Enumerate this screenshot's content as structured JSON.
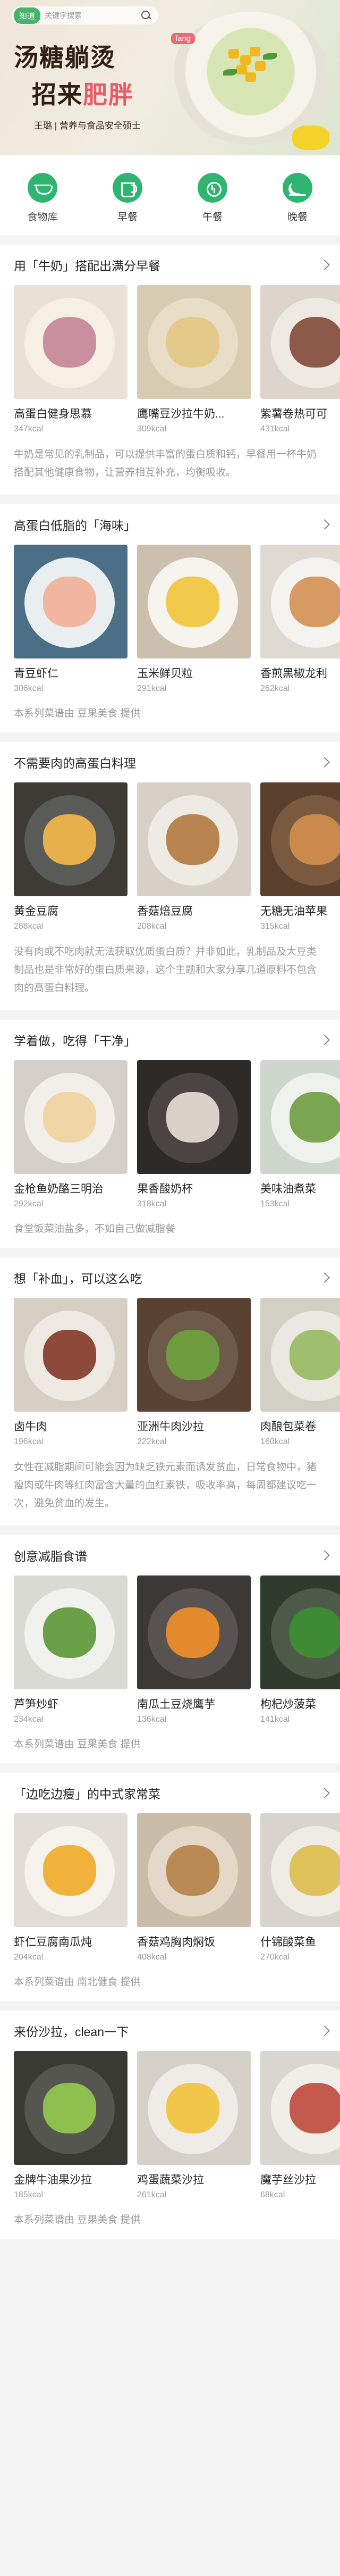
{
  "hero": {
    "search_category": "知道",
    "search_placeholder": "关键字搜索",
    "title_line1": "汤糖躺烫",
    "title_line2_prefix": "招来",
    "title_line2_highlight": "肥胖",
    "tag": "fang",
    "author": "王璐 | 营养与食品安全硕士"
  },
  "nav": [
    {
      "label": "食物库",
      "icon": "bowl-icon"
    },
    {
      "label": "早餐",
      "icon": "cup-icon"
    },
    {
      "label": "午餐",
      "icon": "sun-icon"
    },
    {
      "label": "晚餐",
      "icon": "moon-icon"
    }
  ],
  "colors": {
    "accent": "#2fb471",
    "highlight": "#e85a68"
  },
  "sections": [
    {
      "title": "用「牛奶」搭配出满分早餐",
      "cards": [
        {
          "name": "高蛋白健身思慕",
          "kcal": "347kcal",
          "bg": "#e9e1d6",
          "plate": "#f6efe4",
          "food": "#c98f9e"
        },
        {
          "name": "鹰嘴豆沙拉牛奶...",
          "kcal": "309kcal",
          "bg": "#d7cbb2",
          "plate": "#e8ddc6",
          "food": "#e3c98a"
        },
        {
          "name": "紫薯卷热可可",
          "kcal": "431kcal",
          "bg": "#ddd4cc",
          "plate": "#efe9e4",
          "food": "#8d5a4a"
        }
      ],
      "desc": "牛奶是常见的乳制品，可以提供丰富的蛋白质和钙，早餐用一杯牛奶搭配其他健康食物，让营养相互补充，均衡吸收。",
      "source": ""
    },
    {
      "title": "高蛋白低脂的「海味」",
      "cards": [
        {
          "name": "青豆虾仁",
          "kcal": "306kcal",
          "bg": "#4b6f86",
          "plate": "#e9eef0",
          "food": "#f0b6a0"
        },
        {
          "name": "玉米鲜贝粒",
          "kcal": "291kcal",
          "bg": "#cdbfae",
          "plate": "#f7f3ee",
          "food": "#f1c94b"
        },
        {
          "name": "香煎黑椒龙利",
          "kcal": "262kcal",
          "bg": "#dedad2",
          "plate": "#f5f3ef",
          "food": "#d79a62"
        }
      ],
      "desc": "",
      "source": "本系列菜谱由 豆果美食 提供"
    },
    {
      "title": "不需要肉的高蛋白料理",
      "cards": [
        {
          "name": "黄金豆腐",
          "kcal": "288kcal",
          "bg": "#3e3a36",
          "plate": "#5a5a58",
          "food": "#e8b04a"
        },
        {
          "name": "香菇焙豆腐",
          "kcal": "208kcal",
          "bg": "#d6d0c6",
          "plate": "#eeebe5",
          "food": "#b8844f"
        },
        {
          "name": "无糖无油苹果",
          "kcal": "315kcal",
          "bg": "#5a3f2c",
          "plate": "#7a5a3e",
          "food": "#c98a4c"
        }
      ],
      "desc": "没有肉或不吃肉就无法获取优质蛋白质？并非如此，乳制品及大豆类制品也是非常好的蛋白质来源，这个主题和大家分享几道原料不包含肉的高蛋白料理。",
      "source": ""
    },
    {
      "title": "学着做，吃得「干净」",
      "cards": [
        {
          "name": "金枪鱼奶酪三明治",
          "kcal": "292kcal",
          "bg": "#d4cfc8",
          "plate": "#f2efeb",
          "food": "#f0d6a4"
        },
        {
          "name": "果香酸奶杯",
          "kcal": "318kcal",
          "bg": "#2e2a28",
          "plate": "#4a4442",
          "food": "#d9d2c8"
        },
        {
          "name": "美味油煮菜",
          "kcal": "153kcal",
          "bg": "#cfd6cd",
          "plate": "#eef1ec",
          "food": "#7aa552"
        }
      ],
      "desc": "",
      "source": "食堂饭菜油盐多，不如自己做减脂餐"
    },
    {
      "title": "想「补血」，可以这么吃",
      "cards": [
        {
          "name": "卤牛肉",
          "kcal": "196kcal",
          "bg": "#d8cfc4",
          "plate": "#eee9e2",
          "food": "#8b4a3a"
        },
        {
          "name": "亚洲牛肉沙拉",
          "kcal": "222kcal",
          "bg": "#5a4232",
          "plate": "#6e5a48",
          "food": "#6e9b3e"
        },
        {
          "name": "肉酿包菜卷",
          "kcal": "160kcal",
          "bg": "#d2cfc5",
          "plate": "#eae8e1",
          "food": "#9fbf6e"
        }
      ],
      "desc": "女性在减脂期间可能会因为缺乏铁元素而诱发贫血，日常食物中，猪瘦肉或牛肉等红肉富含大量的血红素铁，吸收率高，每周都建议吃一次，避免贫血的发生。",
      "source": ""
    },
    {
      "title": "创意减脂食谱",
      "cards": [
        {
          "name": "芦笋炒虾",
          "kcal": "234kcal",
          "bg": "#d9dad4",
          "plate": "#f1f2ee",
          "food": "#6aa048"
        },
        {
          "name": "南瓜土豆烧鹰芋",
          "kcal": "136kcal",
          "bg": "#3c3836",
          "plate": "#585250",
          "food": "#e48a2e"
        },
        {
          "name": "枸杞炒菠菜",
          "kcal": "141kcal",
          "bg": "#2f3a2c",
          "plate": "#4e5a48",
          "food": "#3f8a34"
        }
      ],
      "desc": "",
      "source": "本系列菜谱由 豆果美食 提供"
    },
    {
      "title": "「边吃边瘦」的中式家常菜",
      "cards": [
        {
          "name": "虾仁豆腐南瓜炖",
          "kcal": "204kcal",
          "bg": "#e2ddd4",
          "plate": "#f6f3ec",
          "food": "#f0b23a"
        },
        {
          "name": "香菇鸡胸肉焖饭",
          "kcal": "408kcal",
          "bg": "#c9bca8",
          "plate": "#e4d9c8",
          "food": "#b98a54"
        },
        {
          "name": "什锦酸菜鱼",
          "kcal": "270kcal",
          "bg": "#d8d4cd",
          "plate": "#efece6",
          "food": "#e0c25a"
        }
      ],
      "desc": "",
      "source": "本系列菜谱由 南北健食 提供"
    },
    {
      "title": "来份沙拉，clean一下",
      "cards": [
        {
          "name": "金牌牛油果沙拉",
          "kcal": "185kcal",
          "bg": "#3a3a34",
          "plate": "#565650",
          "food": "#8fbf4e"
        },
        {
          "name": "鸡蛋蔬菜沙拉",
          "kcal": "261kcal",
          "bg": "#d6d1c8",
          "plate": "#efece7",
          "food": "#f2c64a"
        },
        {
          "name": "魔芋丝沙拉",
          "kcal": "68kcal",
          "bg": "#d9d6cf",
          "plate": "#f0eee9",
          "food": "#c45a4e"
        }
      ],
      "desc": "",
      "source": "本系列菜谱由 豆果美食 提供"
    }
  ]
}
